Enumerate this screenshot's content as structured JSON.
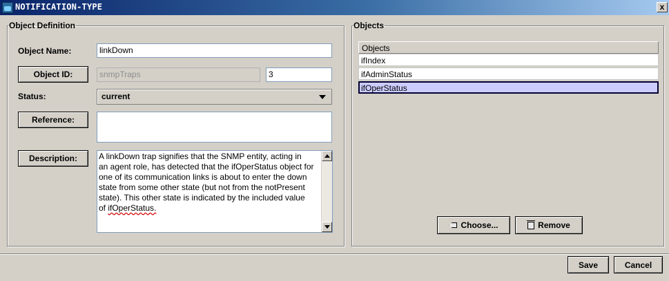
{
  "window": {
    "title": "NOTIFICATION-TYPE",
    "close_label": "x"
  },
  "object_definition": {
    "legend": "Object Definition",
    "object_name_label": "Object Name:",
    "object_name_value": "linkDown",
    "object_id_button": "Object ID:",
    "object_id_parent": "snmpTraps",
    "object_id_number": "3",
    "status_label": "Status:",
    "status_value": "current",
    "reference_button": "Reference:",
    "reference_value": "",
    "description_button": "Description:",
    "description_lines": [
      "A linkDown trap signifies that the SNMP entity, acting in",
      "an agent role, has detected that the ifOperStatus object for",
      "one of its communication links is about to enter the down",
      "state from some other state (but not from the notPresent",
      "state).  This other state is indicated by the included value",
      "of "
    ],
    "description_last_word": "ifOperStatus.",
    "description_spellchecked": true
  },
  "objects_panel": {
    "legend": "Objects",
    "column_header": "Objects",
    "rows": [
      "ifIndex",
      "ifAdminStatus",
      "ifOperStatus"
    ],
    "selected_row": 2,
    "choose_button": "Choose...",
    "remove_button": "Remove"
  },
  "footer": {
    "save_button": "Save",
    "cancel_button": "Cancel"
  },
  "colors": {
    "title_bar": "#0a246a",
    "dialog_background": "#d4d0c8",
    "selected_row": "#ccccff"
  }
}
